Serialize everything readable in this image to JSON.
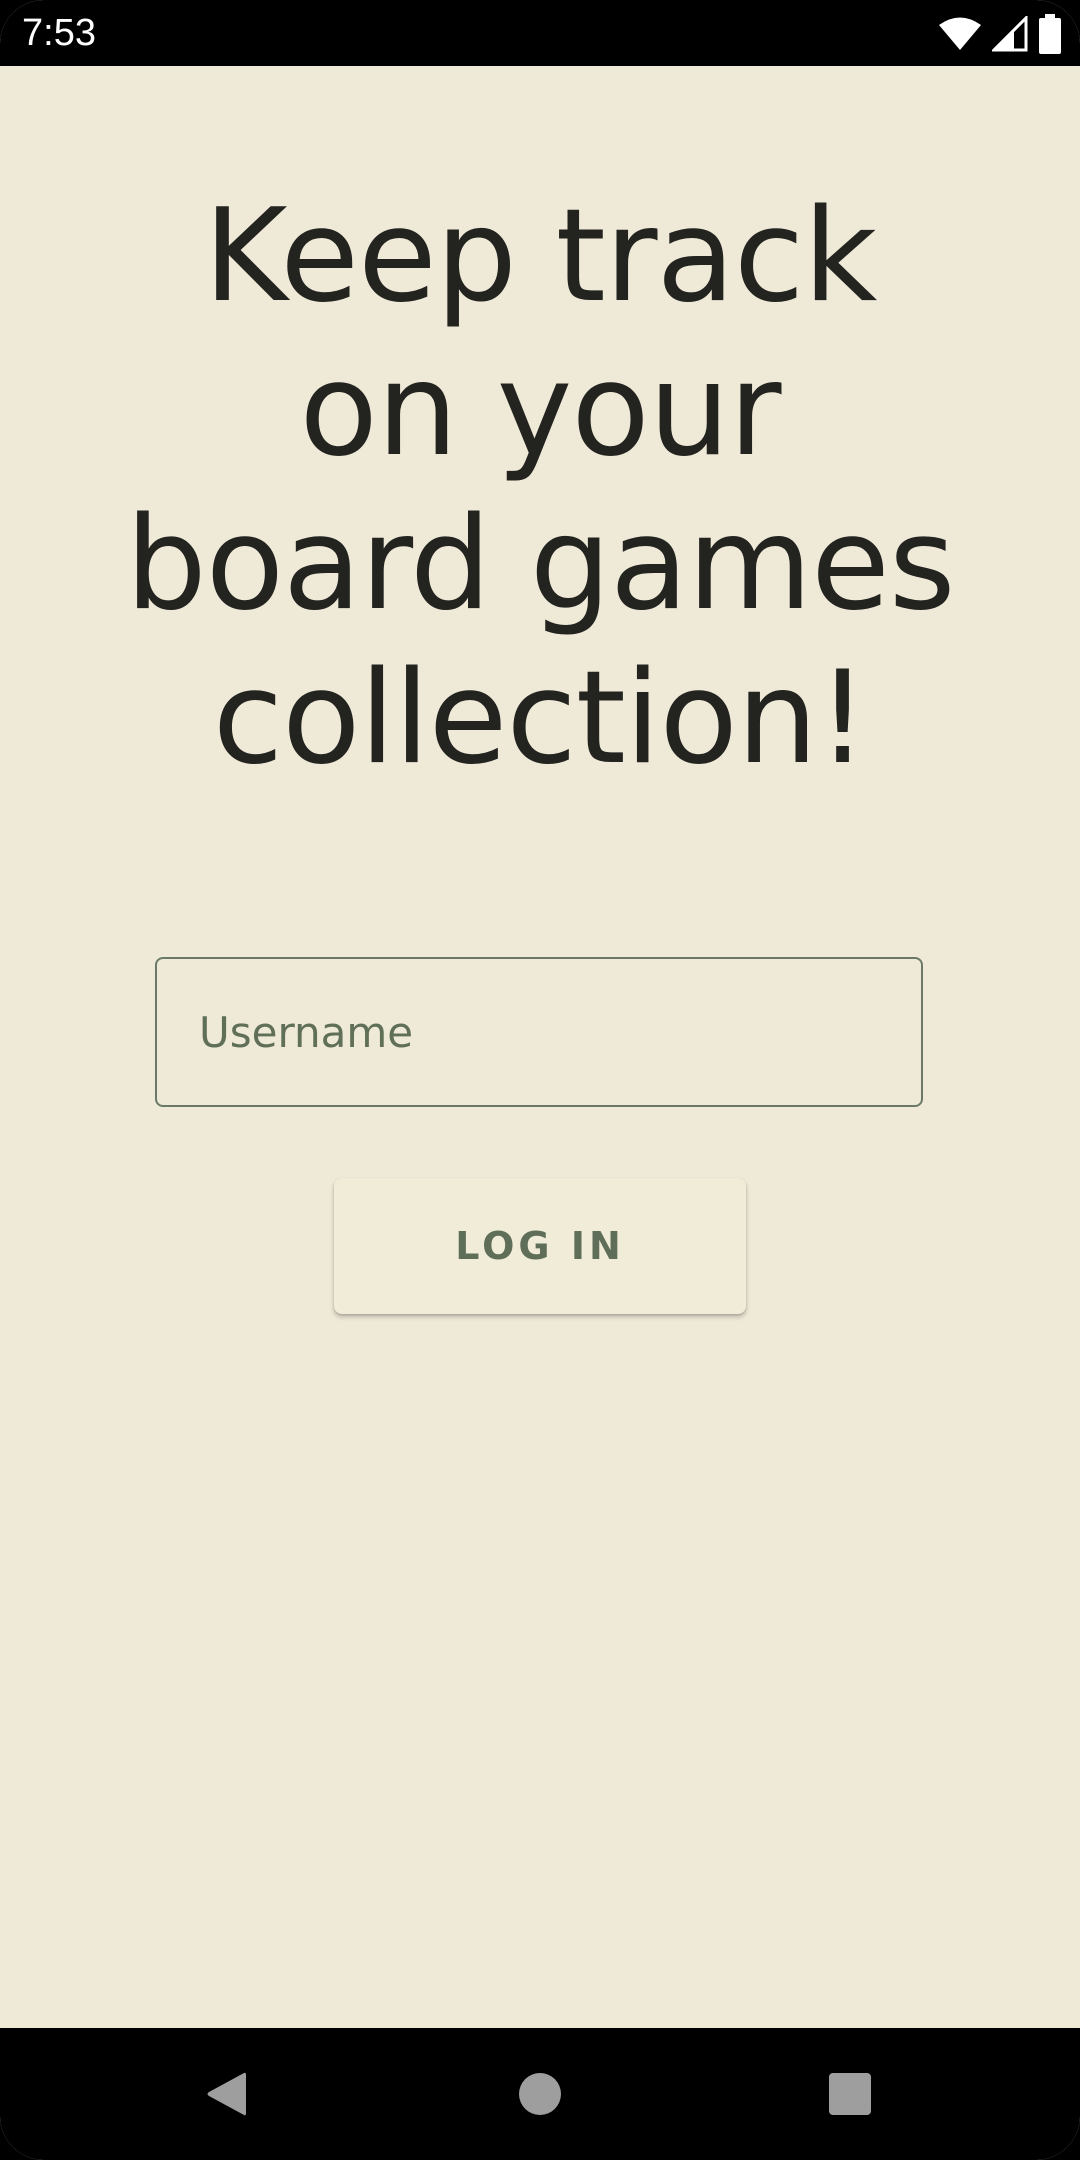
{
  "status_bar": {
    "time": "7:53",
    "icons": [
      "wifi-icon",
      "cellular-signal-icon",
      "battery-icon"
    ]
  },
  "main": {
    "headline": "Keep track on your board games collection!",
    "username_field": {
      "placeholder": "Username",
      "value": ""
    },
    "login_button_label": "LOG IN"
  },
  "nav_bar": {
    "icons": [
      "back-icon",
      "home-icon",
      "recents-icon"
    ]
  },
  "colors": {
    "background": "#efe9d8",
    "text": "#23231f",
    "accent": "#5e6e58",
    "field_border": "#6b7a66",
    "button_bg": "#f1ecd8"
  }
}
